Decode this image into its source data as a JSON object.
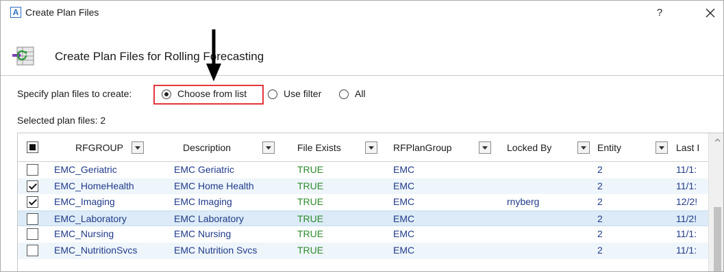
{
  "window": {
    "app_icon_letter": "A",
    "title": "Create Plan Files",
    "help_label": "?",
    "close_label": "close"
  },
  "header": {
    "icon": "plan-files-refresh-icon",
    "title": "Create Plan Files for Rolling Forecasting"
  },
  "options": {
    "label": "Specify plan files to create:",
    "choices": [
      {
        "label": "Choose from list",
        "selected": true
      },
      {
        "label": "Use filter",
        "selected": false
      },
      {
        "label": "All",
        "selected": false
      }
    ]
  },
  "selected_summary": "Selected plan files: 2",
  "colors": {
    "highlight_box": "#e4353a",
    "link_text": "#1f3a8a",
    "true_text": "#2e8b2e"
  },
  "grid": {
    "columns": [
      {
        "label": "RFGROUP",
        "filter": true
      },
      {
        "label": "Description",
        "filter": true
      },
      {
        "label": "File Exists",
        "filter": true
      },
      {
        "label": "RFPlanGroup",
        "filter": true
      },
      {
        "label": "Locked By",
        "filter": true
      },
      {
        "label": "Entity",
        "filter": true
      },
      {
        "label": "Last I",
        "filter": false
      }
    ],
    "rows": [
      {
        "checked": false,
        "rfgroup": "EMC_Geriatric",
        "description": "EMC Geriatric",
        "file_exists": "TRUE",
        "rfplangroup": "EMC",
        "locked_by": "",
        "entity": "2",
        "last": "11/1:"
      },
      {
        "checked": true,
        "rfgroup": "EMC_HomeHealth",
        "description": "EMC Home Health",
        "file_exists": "TRUE",
        "rfplangroup": "EMC",
        "locked_by": "",
        "entity": "2",
        "last": "11/1:"
      },
      {
        "checked": true,
        "rfgroup": "EMC_Imaging",
        "description": "EMC Imaging",
        "file_exists": "TRUE",
        "rfplangroup": "EMC",
        "locked_by": "rnyberg",
        "entity": "2",
        "last": "12/2!"
      },
      {
        "checked": false,
        "rfgroup": "EMC_Laboratory",
        "description": "EMC Laboratory",
        "file_exists": "TRUE",
        "rfplangroup": "EMC",
        "locked_by": "",
        "entity": "2",
        "last": "11/2!"
      },
      {
        "checked": false,
        "rfgroup": "EMC_Nursing",
        "description": "EMC Nursing",
        "file_exists": "TRUE",
        "rfplangroup": "EMC",
        "locked_by": "",
        "entity": "2",
        "last": "11/1:"
      },
      {
        "checked": false,
        "rfgroup": "EMC_NutritionSvcs",
        "description": "EMC Nutrition Svcs",
        "file_exists": "TRUE",
        "rfplangroup": "EMC",
        "locked_by": "",
        "entity": "2",
        "last": "11/1:"
      }
    ]
  }
}
